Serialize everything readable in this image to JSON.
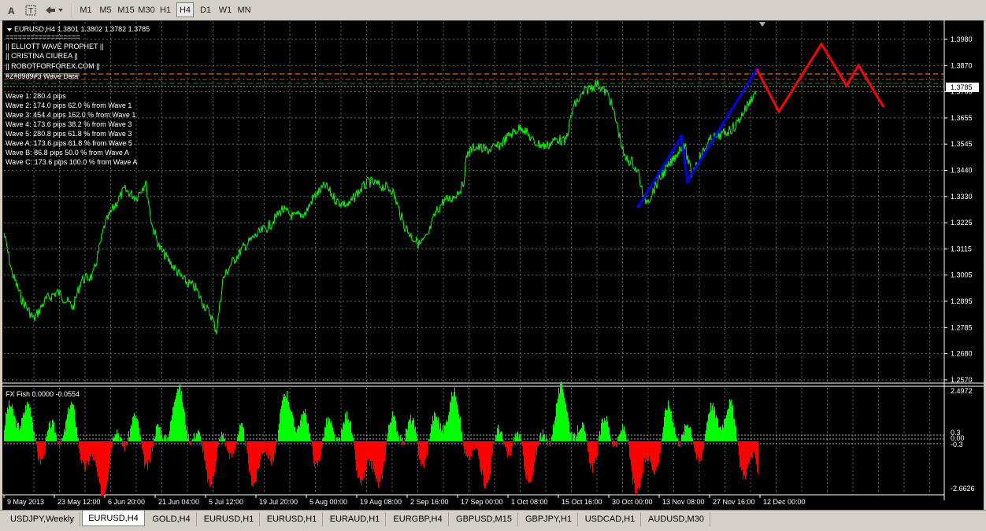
{
  "toolbar": {
    "timeframes": [
      "M1",
      "M5",
      "M15",
      "M30",
      "H1",
      "H4",
      "D1",
      "W1",
      "MN"
    ],
    "active_timeframe": "H4"
  },
  "main_chart": {
    "header": "EURUSD,H4  1.3801 1.3802 1.3782 1.3785",
    "info_lines": [
      "==================",
      "||   ELLIOTT WAVE PROPHET   ||",
      "||      CRISTINA CIUREA      ||",
      "||   ROBOTFORFOREX.COM   ||",
      "==================",
      "#Z#8989#3 Wave Data"
    ],
    "wave_data": [
      "Wave 1: 280.4 pips",
      "Wave 2: 174.0 pips 62.0 % from Wave 1",
      "Wave 3: 454.4 pips 162.0 % from Wave 1",
      "Wave 4: 173.6 pips 38.2 % from Wave 3",
      "Wave 5: 280.8 pips 61.8 % from Wave 3",
      "Wave A: 173.6 pips 61.8 % from Wave 5",
      "Wave B: 86.8 pips 50.0 % from Wave A",
      "Wave C: 173.6 pips 100.0 % from Wave A"
    ],
    "price_labels": [
      "1.3980",
      "1.3870",
      "1.3760",
      "1.3655",
      "1.3545",
      "1.3440",
      "1.3330",
      "1.3225",
      "1.3115",
      "1.3005",
      "1.2895",
      "1.2785",
      "1.2680",
      "1.2570"
    ],
    "current_price": "1.3785",
    "colors": {
      "price_line": "#00ff00",
      "elliott_past": "#0000ff",
      "elliott_projection": "#ff0000",
      "grid": "#5a6a6a"
    }
  },
  "indicator": {
    "header": "FX Fish 0.0000 -0.0554",
    "labels": {
      "max": "2.4972",
      "upper": "0.3",
      "zero": "0.00",
      "lower": "-0.3",
      "min": "-2.6626"
    },
    "colors": {
      "positive": "#00ff00",
      "negative": "#ff0000"
    }
  },
  "time_labels": [
    "9 May 2013",
    "23 May 12:00",
    "6 Jun 20:00",
    "21 Jun 04:00",
    "5 Jul 12:00",
    "19 Jul 20:00",
    "5 Aug 00:00",
    "19 Aug 08:00",
    "2 Sep 16:00",
    "17 Sep 00:00",
    "1 Oct 08:00",
    "15 Oct 16:00",
    "30 Oct 00:00",
    "13 Nov 08:00",
    "27 Nov 16:00",
    "12 Dec 00:00"
  ],
  "tabs": [
    "USDJPY,Weekly",
    "EURUSD,H4",
    "GOLD,H4",
    "EURUSD,H1",
    "EURUSD,H1",
    "EURAUD,H1",
    "EURGBP,H4",
    "GBPUSD,M15",
    "GBPJPY,H1",
    "USDCAD,H1",
    "AUDUSD,M30"
  ],
  "active_tab": "EURUSD,H4"
}
